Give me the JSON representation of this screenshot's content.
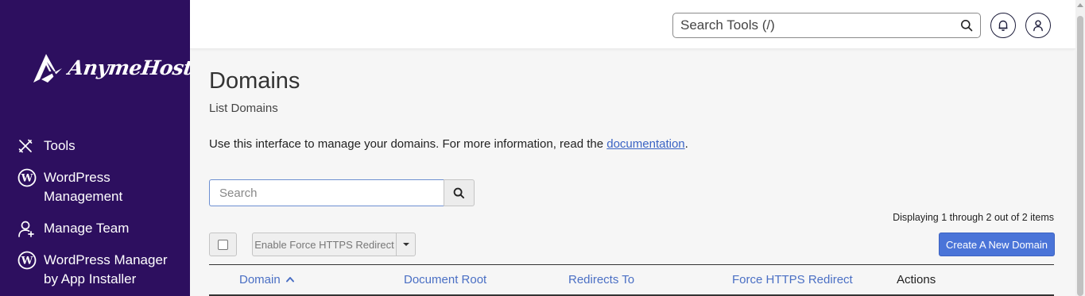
{
  "sidebar": {
    "logo_text": "AnymeHost",
    "items": [
      {
        "label": "Tools",
        "icon": "tools-icon"
      },
      {
        "label": "WordPress Management",
        "icon": "wordpress-icon"
      },
      {
        "label": "Manage Team",
        "icon": "manage-team-icon"
      },
      {
        "label": "WordPress Manager by App Installer",
        "icon": "wordpress-icon"
      }
    ]
  },
  "header": {
    "search_placeholder": "Search Tools (/)",
    "search_icon": "search-icon",
    "notifications_icon": "bell-icon",
    "user_icon": "user-icon"
  },
  "page": {
    "title": "Domains",
    "subtitle": "List Domains",
    "intro_text": "Use this interface to manage your domains. For more information, read the ",
    "intro_link": "documentation",
    "intro_suffix": "."
  },
  "toolbar": {
    "search_placeholder": "Search",
    "count_text": "Displaying 1 through 2 out of 2 items",
    "https_button_label": "Enable Force HTTPS Redirect",
    "create_button_label": "Create A New Domain"
  },
  "table": {
    "columns": [
      "Domain",
      "Document Root",
      "Redirects To",
      "Force HTTPS Redirect",
      "Actions"
    ],
    "sort_column": "Domain",
    "sort_direction": "ascending"
  },
  "colors": {
    "sidebar_bg": "#2d0f5f",
    "accent": "#4a74d8",
    "link": "#4a6fc4"
  }
}
